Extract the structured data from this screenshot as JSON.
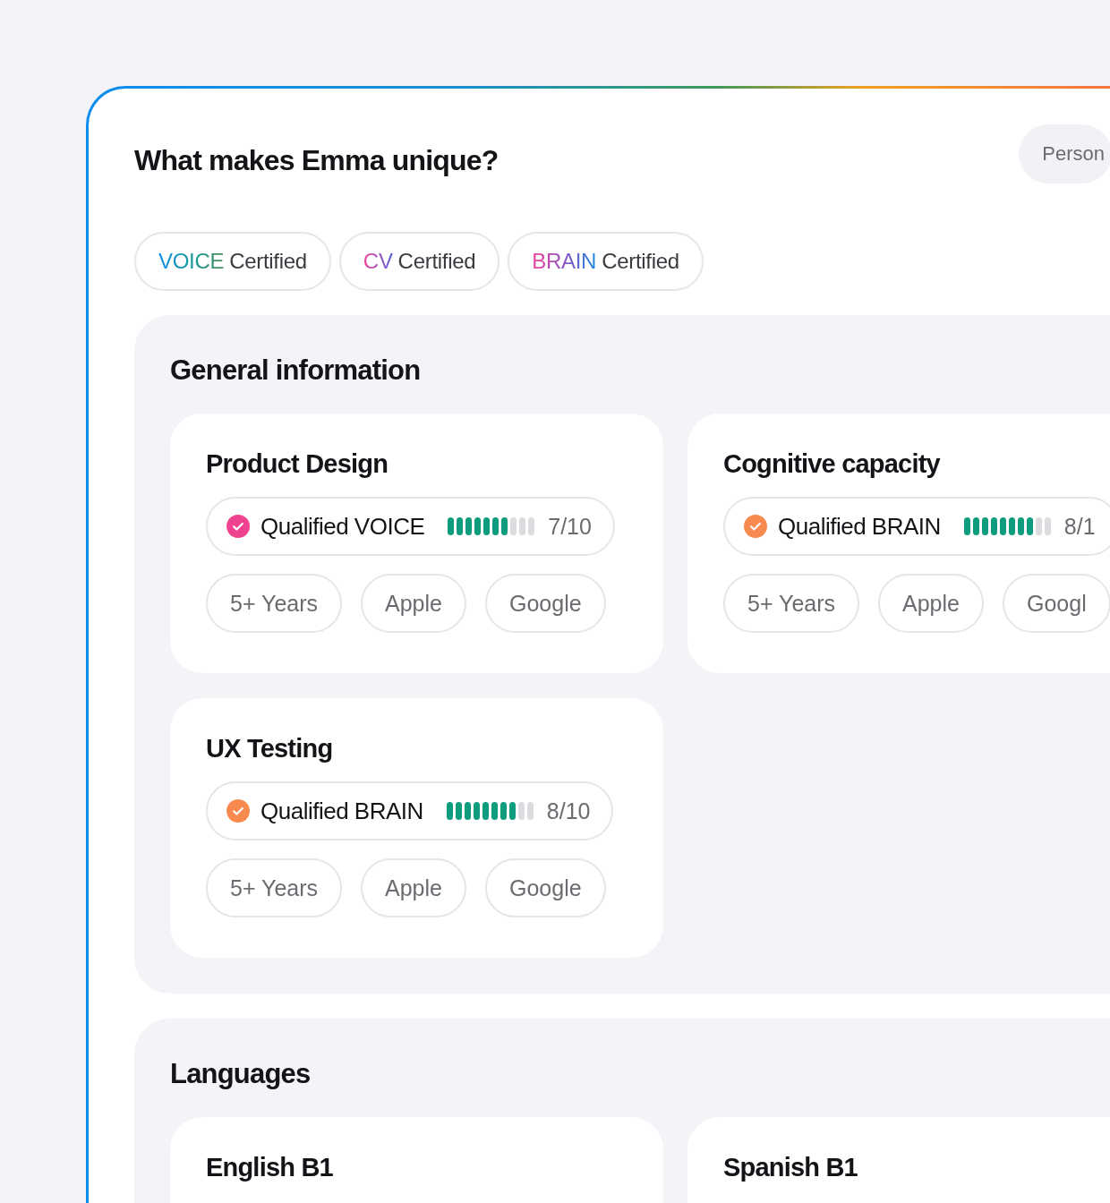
{
  "title": "What makes Emma unique?",
  "tag": "Person",
  "certifications": [
    {
      "kind": "voice",
      "brand": "VOICE",
      "label": "Certified"
    },
    {
      "kind": "cv",
      "brand": "CV",
      "label": "Certified"
    },
    {
      "kind": "brain",
      "brand": "BRAIN",
      "label": "Certified"
    }
  ],
  "sections": [
    {
      "title": "General information",
      "cards": [
        {
          "title": "Product Design",
          "qualification": {
            "label": "Qualified VOICE",
            "color": "#f0438f",
            "level": 0.7,
            "reading": "7/10"
          },
          "tags": [
            "5+ Years",
            "Apple",
            "Google"
          ]
        },
        {
          "title": "Cognitive capacity",
          "qualification": {
            "label": "Qualified BRAIN",
            "color": "#f98a4f",
            "level": 0.8,
            "reading": "8/1"
          },
          "tags": [
            "5+ Years",
            "Apple",
            "Googl"
          ]
        },
        {
          "title": "UX Testing",
          "qualification": {
            "label": "Qualified BRAIN",
            "color": "#f98a4f",
            "level": 0.8,
            "reading": "8/10"
          },
          "tags": [
            "5+ Years",
            "Apple",
            "Google"
          ]
        }
      ]
    },
    {
      "title": "Languages",
      "cards": [
        {
          "title": "English B1"
        },
        {
          "title": "Spanish B1"
        }
      ]
    }
  ]
}
